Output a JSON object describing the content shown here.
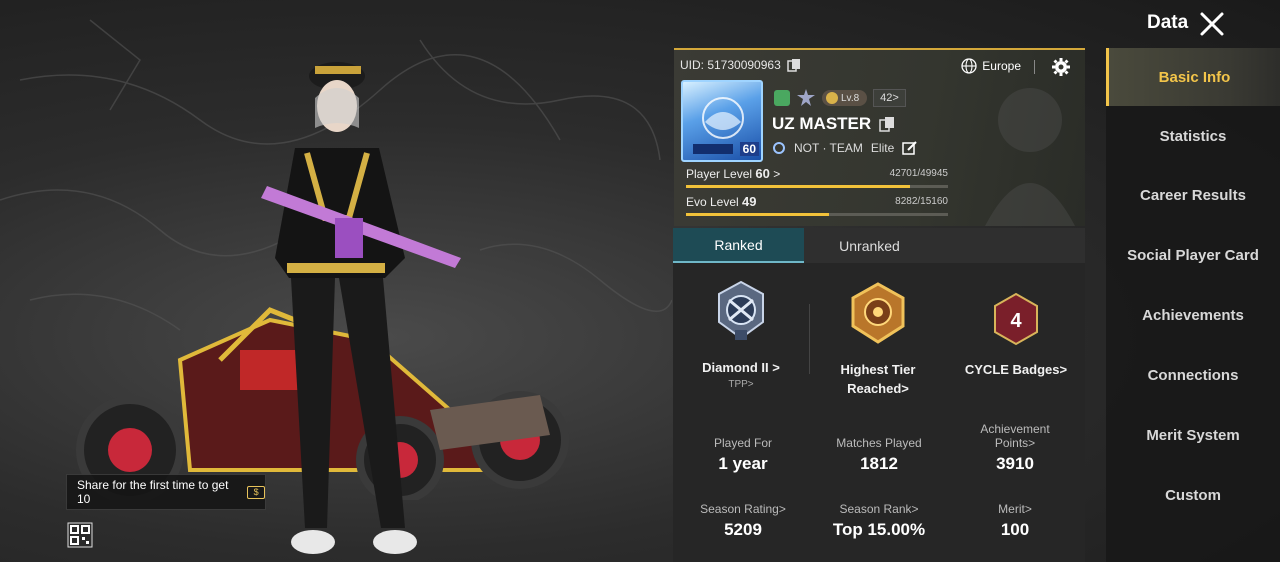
{
  "header": {
    "title": "Data"
  },
  "share": {
    "tip": "Share for the first time to get 10",
    "coin_symbol": "$"
  },
  "profile": {
    "uid": "UID: 51730090963",
    "region": "Europe",
    "avatar_level": "60",
    "lv_pill": "Lv.8",
    "popularity": "42>",
    "name": "UZ MASTER",
    "team": "NOT · TEAM",
    "team_tier": "Elite",
    "player_level_label": "Player Level",
    "player_level": "60",
    "player_level_arrow": ">",
    "player_xp": "42701/49945",
    "player_xp_fraction": 0.855,
    "evo_level_label": "Evo Level",
    "evo_level": "49",
    "evo_xp": "8282/15160",
    "evo_xp_fraction": 0.546
  },
  "tabs": [
    "Ranked",
    "Unranked"
  ],
  "ranks": {
    "current": "Diamond II >",
    "mode": "TPP>",
    "highest_line1": "Highest Tier",
    "highest_line2": "Reached>",
    "cycle": "CYCLE Badges>",
    "cycle_num": "4"
  },
  "stats": [
    {
      "label": "Played For",
      "value": "1 year"
    },
    {
      "label": "Matches Played",
      "value": "1812"
    },
    {
      "label": "Achievement Points>",
      "value": "3910"
    },
    {
      "label": "Season Rating>",
      "value": "5209"
    },
    {
      "label": "Season Rank>",
      "value": "Top 15.00%"
    },
    {
      "label": "Merit>",
      "value": "100"
    }
  ],
  "nav": [
    "Basic Info",
    "Statistics",
    "Career Results",
    "Social Player Card",
    "Achievements",
    "Connections",
    "Merit System",
    "Custom"
  ],
  "colors": {
    "accent": "#f3c54a",
    "tab_active": "#1e4b55",
    "panel": "#262626"
  }
}
